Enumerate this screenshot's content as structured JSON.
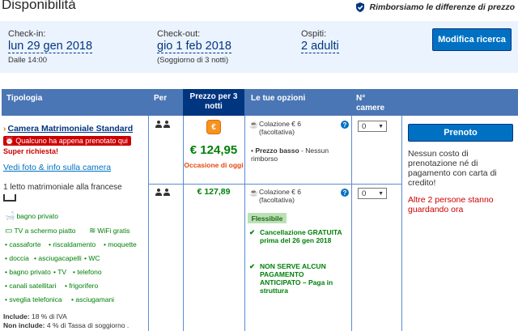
{
  "header": {
    "title": "Disponibilità",
    "refund_text": "Rimborsiamo le differenze di prezzo"
  },
  "summary": {
    "checkin_label": "Check-in:",
    "checkin_value": "lun 29 gen 2018",
    "checkin_sub": "Dalle 14:00",
    "checkout_label": "Check-out:",
    "checkout_value": "gio 1 feb 2018",
    "checkout_sub": "(Soggiorno di 3 notti)",
    "guests_label": "Ospiti:",
    "guests_value": "2 adulti",
    "modify_button": "Modifica ricerca"
  },
  "table": {
    "headers": {
      "type": "Tipologia",
      "per": "Per",
      "price": "Prezzo per 3 notti",
      "options": "Le tue opzioni",
      "rooms": "N° camere"
    }
  },
  "room": {
    "name": "Camera Matrimoniale Standard",
    "booked_badge": "Qualcuno ha appena prenotato qui",
    "super_requested": "Super richiesta!",
    "photos_link": "Vedi foto & info sulla camera",
    "bed": "1 letto matrimoniale alla francese",
    "features": {
      "private_bathroom": "bagno privato",
      "flat_tv": "TV a schermo piatto",
      "wifi": "WiFi gratis",
      "safe": "cassaforte",
      "heating": "riscaldamento",
      "carpet": "moquette",
      "shower": "doccia",
      "hairdryer": "asciugacapelli",
      "wc": "WC",
      "bath": "bagno privato",
      "tv": "TV",
      "phone": "telefono",
      "satellite": "canali satellitari",
      "fridge": "frigorifero",
      "wakeup": "sveglia telefonica",
      "towels": "asciugamani"
    },
    "includes_label": "Include:",
    "includes_text": "18 % di IVA",
    "not_includes_label": "Non include:",
    "not_includes_text": "4 % di Tassa di soggiorno ."
  },
  "options": [
    {
      "price": "€ 124,95",
      "deal_label": "Occasione di oggi",
      "breakfast": "Colazione € 6 (facoltativa)",
      "policy_bold": "Prezzo basso",
      "policy_rest": "- Nessun rimborso",
      "qty": "0"
    },
    {
      "price": "€ 127,89",
      "breakfast": "Colazione € 6 (facoltativa)",
      "flex_badge": "Flessibile",
      "cancellation": "Cancellazione GRATUITA prima del 26 gen 2018",
      "no_prepay": "NON SERVE ALCUN PAGAMENTO ANTICIPATO – Paga in struttura",
      "qty": "0"
    }
  ],
  "booking": {
    "book_button": "Prenoto",
    "no_cost": "Nessun costo di prenotazione né di pagamento con carta di credito!",
    "watching": "Altre 2 persone stanno guardando ora"
  },
  "colors": {
    "header_blue": "#4b76b5",
    "price_header": "#003580",
    "accent": "#0071c2",
    "green": "#008009",
    "red": "#cc0000"
  }
}
